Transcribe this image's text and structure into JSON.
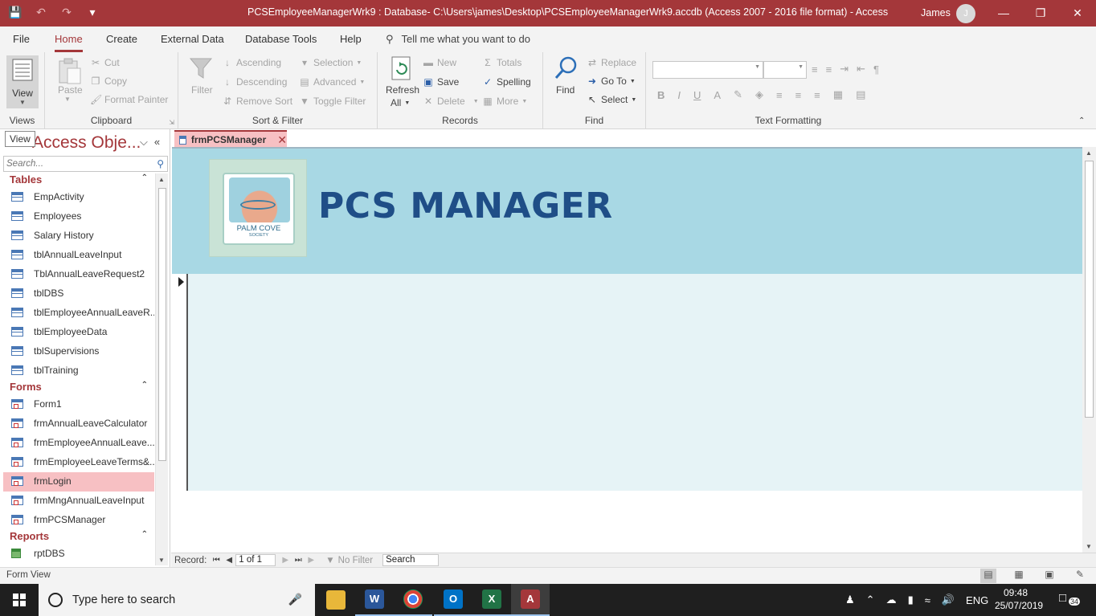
{
  "titlebar": {
    "title": "PCSEmployeeManagerWrk9 : Database- C:\\Users\\james\\Desktop\\PCSEmployeeManagerWrk9.accdb (Access 2007 - 2016 file format)  -  Access",
    "user": "James",
    "avatar_initial": "J",
    "accent": "#a4373a"
  },
  "menu": {
    "tabs": [
      "File",
      "Home",
      "Create",
      "External Data",
      "Database Tools",
      "Help"
    ],
    "active": "Home",
    "tell_me": "Tell me what you want to do"
  },
  "ribbon": {
    "views": {
      "view_label": "View",
      "group_label": "Views"
    },
    "clipboard": {
      "paste": "Paste",
      "cut": "Cut",
      "copy": "Copy",
      "format_painter": "Format Painter",
      "group_label": "Clipboard"
    },
    "sort_filter": {
      "filter": "Filter",
      "ascending": "Ascending",
      "descending": "Descending",
      "remove_sort": "Remove Sort",
      "selection": "Selection",
      "advanced": "Advanced",
      "toggle_filter": "Toggle Filter",
      "group_label": "Sort & Filter"
    },
    "records": {
      "refresh_all": "Refresh",
      "refresh_all_2": "All",
      "new": "New",
      "save": "Save",
      "delete": "Delete",
      "totals": "Totals",
      "spelling": "Spelling",
      "more": "More",
      "group_label": "Records"
    },
    "find": {
      "find": "Find",
      "replace": "Replace",
      "go_to": "Go To",
      "select": "Select",
      "group_label": "Find"
    },
    "text_formatting": {
      "bold": "B",
      "italic": "I",
      "underline": "U",
      "group_label": "Text Formatting"
    }
  },
  "navpane": {
    "tooltip": "View",
    "title": "Access Obje...",
    "search_placeholder": "Search...",
    "sections": [
      {
        "label": "Tables",
        "type": "table",
        "items": [
          "EmpActivity",
          "Employees",
          "Salary History",
          "tblAnnualLeaveInput",
          "TblAnnualLeaveRequest2",
          "tblDBS",
          "tblEmployeeAnnualLeaveR...",
          "tblEmployeeData",
          "tblSupervisions",
          "tblTraining"
        ]
      },
      {
        "label": "Forms",
        "type": "form",
        "items": [
          "Form1",
          "frmAnnualLeaveCalculator",
          "frmEmployeeAnnualLeave...",
          "frmEmployeeLeaveTerms&...",
          "frmLogin",
          "frmMngAnnualLeaveInput",
          "frmPCSManager"
        ],
        "selected": "frmLogin"
      },
      {
        "label": "Reports",
        "type": "report",
        "items": [
          "rptDBS"
        ]
      }
    ]
  },
  "document": {
    "tab_label": "frmPCSManager",
    "header_title": "PCS MANAGER",
    "logo_text": "PALM COVE",
    "logo_subtext": "SOCIETY",
    "header_color": "#a8d8e4",
    "title_color": "#1f4e87"
  },
  "record_nav": {
    "label": "Record:",
    "current": "1 of 1",
    "filter_status": "No Filter",
    "search": "Search"
  },
  "statusbar": {
    "text": "Form View"
  },
  "taskbar": {
    "search_placeholder": "Type here to search",
    "lang": "ENG",
    "time": "09:48",
    "date": "25/07/2019",
    "notifications": "34"
  }
}
